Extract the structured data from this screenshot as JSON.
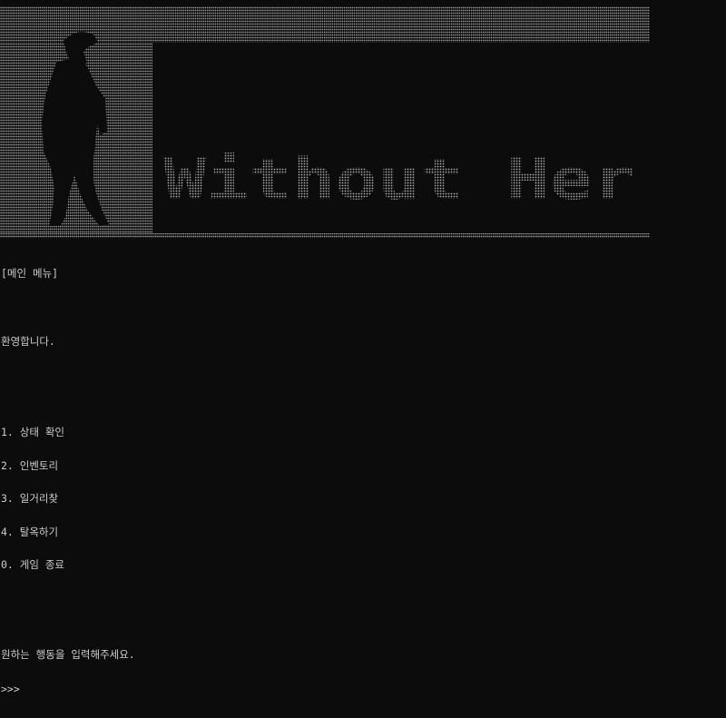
{
  "banner": {
    "title": "Without Her"
  },
  "console": {
    "section_header": "[메인 메뉴]",
    "welcome": "환영합니다.",
    "menu_items": [
      {
        "label": "1. 상태 확인"
      },
      {
        "label": "2. 인벤토리"
      },
      {
        "label": "3. 일거리찾"
      },
      {
        "label": "4. 탈옥하기"
      },
      {
        "label": "0. 게임 종료"
      }
    ],
    "action_prompt": "원하는 행동을 입력해주세요.",
    "prompt_symbol": ">>>",
    "input_value": ""
  },
  "colors": {
    "background": "#0c0c0c",
    "text": "#cccccc",
    "ascii_dots": "#9a9a9a"
  }
}
